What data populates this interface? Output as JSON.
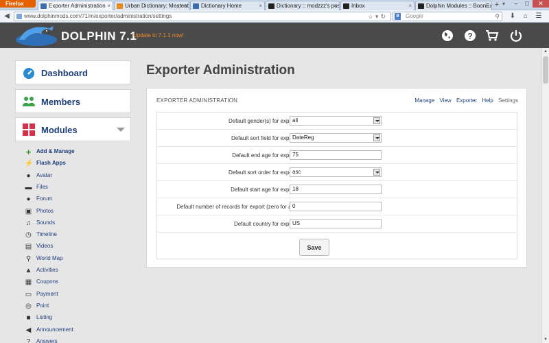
{
  "browser": {
    "menu_button": "Firefox",
    "tabs": [
      {
        "title": "Exporter Administration",
        "favicon_color": "#3b6db3"
      },
      {
        "title": "Urban Dictionary: Meateati...",
        "favicon_color": "#e8891d"
      },
      {
        "title": "Dictionary Home",
        "favicon_color": "#3b6db3"
      },
      {
        "title": "Dictionary :: modzzz's posts",
        "favicon_color": "#222222"
      },
      {
        "title": "Inbox",
        "favicon_color": "#222222"
      },
      {
        "title": "Dolphin Modules :: BoonEx...",
        "favicon_color": "#222222"
      }
    ],
    "new_tab": "+",
    "url": "www.dolphinmods.com/71/m/exporter/administration/settings",
    "search_placeholder": "Google",
    "search_engine_letter": "8"
  },
  "header": {
    "logo_text": "DOLPHIN 7.1",
    "update_link": "Update to 7.1.1 now!"
  },
  "sidebar": {
    "dashboard": "Dashboard",
    "members": "Members",
    "modules": "Modules",
    "items": [
      {
        "label": "Add & Manage",
        "icon": "plus-icon",
        "glyph": "+",
        "color": "#2a9a2a"
      },
      {
        "label": "Flash Apps",
        "icon": "lightning-icon",
        "glyph": "⚡",
        "color": "#d83a8a"
      },
      {
        "label": "Avatar",
        "icon": "user-icon",
        "glyph": "●",
        "color": "#333333"
      },
      {
        "label": "Files",
        "icon": "file-icon",
        "glyph": "▬",
        "color": "#333333"
      },
      {
        "label": "Forum",
        "icon": "chat-icon",
        "glyph": "●",
        "color": "#333333"
      },
      {
        "label": "Photos",
        "icon": "photo-icon",
        "glyph": "▣",
        "color": "#333333"
      },
      {
        "label": "Sounds",
        "icon": "music-icon",
        "glyph": "♫",
        "color": "#333333"
      },
      {
        "label": "Timeline",
        "icon": "clock-icon",
        "glyph": "◷",
        "color": "#333333"
      },
      {
        "label": "Videos",
        "icon": "film-icon",
        "glyph": "▤",
        "color": "#333333"
      },
      {
        "label": "World Map",
        "icon": "map-pin-icon",
        "glyph": "⚲",
        "color": "#333333"
      },
      {
        "label": "Activities",
        "icon": "road-icon",
        "glyph": "▲",
        "color": "#333333"
      },
      {
        "label": "Coupons",
        "icon": "qrcode-icon",
        "glyph": "▦",
        "color": "#333333"
      },
      {
        "label": "Payment",
        "icon": "credit-card-icon",
        "glyph": "▭",
        "color": "#333333"
      },
      {
        "label": "Point",
        "icon": "target-icon",
        "glyph": "◎",
        "color": "#333333"
      },
      {
        "label": "Listing",
        "icon": "briefcase-icon",
        "glyph": "■",
        "color": "#333333"
      },
      {
        "label": "Announcement",
        "icon": "megaphone-icon",
        "glyph": "◀",
        "color": "#333333"
      },
      {
        "label": "Answers",
        "icon": "question-icon",
        "glyph": "?",
        "color": "#333333"
      }
    ]
  },
  "main": {
    "title": "Exporter Administration",
    "panel_title": "EXPORTER ADMINISTRATION",
    "menu": [
      "Manage",
      "View",
      "Exporter",
      "Help",
      "Settings"
    ],
    "fields": [
      {
        "label": "Default gender(s) for export:",
        "value": "all",
        "type": "select"
      },
      {
        "label": "Default sort field for export:",
        "value": "DateReg",
        "type": "select"
      },
      {
        "label": "Default end age for export:",
        "value": "75",
        "type": "input"
      },
      {
        "label": "Default sort order for export:",
        "value": "asc",
        "type": "select"
      },
      {
        "label": "Default start age for export:",
        "value": "18",
        "type": "input"
      },
      {
        "label": "Default number of records for export (zero for all):",
        "value": "0",
        "type": "input"
      },
      {
        "label": "Default country for export:",
        "value": "US",
        "type": "input"
      }
    ],
    "save_label": "Save"
  },
  "colors": {
    "header_bg": "#4a4a4a",
    "link_blue": "#1f3f7a",
    "update_orange": "#f08a24",
    "modules_red": "#d8304a",
    "members_green": "#3aa04a",
    "dashboard_blue": "#2a8ad0"
  }
}
